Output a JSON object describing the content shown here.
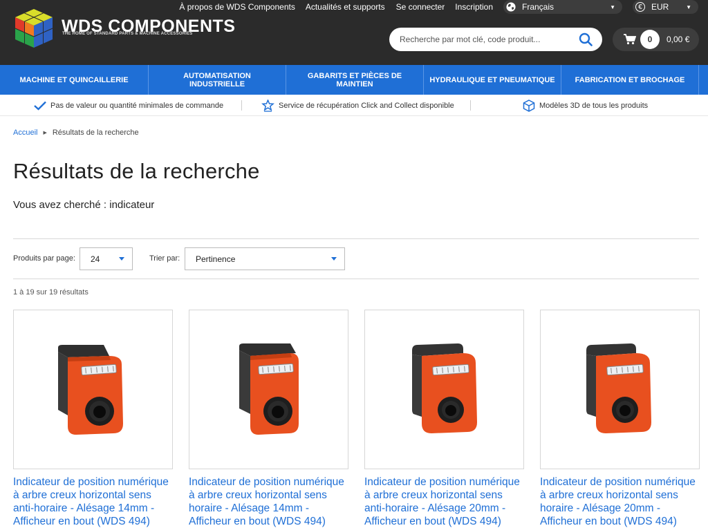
{
  "header": {
    "brand_title": "WDS COMPONENTS",
    "brand_subtitle": "THE HOME OF STANDARD PARTS & MACHINE ACCESSORIES",
    "top_links": {
      "about": "À propos de WDS Components",
      "news": "Actualités et supports",
      "login": "Se connecter",
      "register": "Inscription"
    },
    "language": "Français",
    "currency_symbol": "€",
    "currency": "EUR",
    "search_placeholder": "Recherche par mot clé, code produit...",
    "cart_count": "0",
    "cart_total": "0,00 €"
  },
  "nav": [
    {
      "line1": "MACHINE ET QUINCAILLERIE",
      "line2": ""
    },
    {
      "line1": "AUTOMATISATION",
      "line2": "INDUSTRIELLE"
    },
    {
      "line1": "GABARITS ET PIÈCES DE",
      "line2": "MAINTIEN"
    },
    {
      "line1": "HYDRAULIQUE ET PNEUMATIQUE",
      "line2": ""
    },
    {
      "line1": "FABRICATION ET BROCHAGE",
      "line2": ""
    }
  ],
  "features": [
    {
      "text": "Pas de valeur ou quantité minimales de commande",
      "icon": "checkmark-icon"
    },
    {
      "text": "Service de récupération Click and Collect disponible",
      "icon": "cart-pickup-icon"
    },
    {
      "text": "Modèles 3D de tous les produits",
      "icon": "cube-icon"
    }
  ],
  "breadcrumb": {
    "home": "Accueil",
    "current": "Résultats de la recherche"
  },
  "page_title": "Résultats de la recherche",
  "searched_text": "Vous avez cherché : indicateur",
  "toolbar": {
    "per_page_label": "Produits par page:",
    "per_page_value": "24",
    "sort_label": "Trier par:",
    "sort_value": "Pertinence"
  },
  "result_count": "1 à 19 sur 19 résultats",
  "products": [
    {
      "title": "Indicateur de position numérique à arbre creux horizontal sens anti-horaire - Alésage 14mm - Afficheur en bout (WDS 494)",
      "colors": {
        "body": "#e8501f",
        "cap": "#2e2e2e"
      }
    },
    {
      "title": "Indicateur de position numérique à arbre creux horizontal sens horaire - Alésage 14mm - Afficheur en bout (WDS 494)",
      "colors": {
        "body": "#e8501f",
        "cap": "#2e2e2e"
      }
    },
    {
      "title": "Indicateur de position numérique à arbre creux horizontal sens anti-horaire - Alésage 20mm - Afficheur en bout (WDS 494)",
      "colors": {
        "body": "#e8501f",
        "cap": "#2e2e2e"
      }
    },
    {
      "title": "Indicateur de position numérique à arbre creux horizontal sens horaire - Alésage 20mm - Afficheur en bout (WDS 494)",
      "colors": {
        "body": "#e8501f",
        "cap": "#2e2e2e"
      }
    }
  ],
  "colors": {
    "accent": "#1f6fd6",
    "header_bg": "#2b2b2b"
  }
}
